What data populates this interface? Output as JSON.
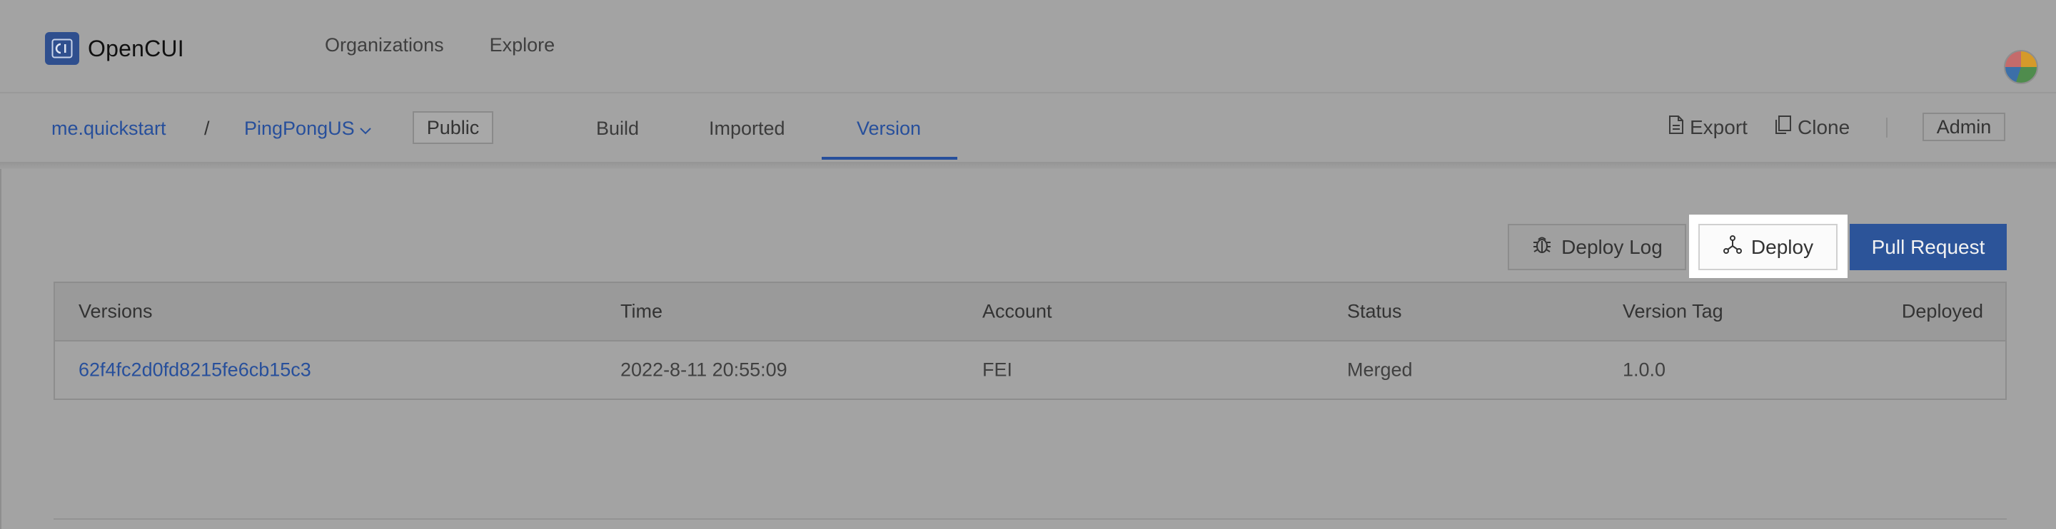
{
  "app": {
    "name": "OpenCUI"
  },
  "topnav": {
    "items": [
      "Organizations",
      "Explore"
    ]
  },
  "breadcrumb": {
    "org": "me.quickstart",
    "separator": "/",
    "project": "PingPongUS",
    "visibility": "Public"
  },
  "tabs": [
    {
      "label": "Build",
      "active": false
    },
    {
      "label": "Imported",
      "active": false
    },
    {
      "label": "Version",
      "active": true
    }
  ],
  "subactions": {
    "export": "Export",
    "clone": "Clone",
    "admin": "Admin"
  },
  "actions": {
    "deploy_log": "Deploy Log",
    "deploy": "Deploy",
    "pull_request": "Pull Request"
  },
  "table": {
    "columns": [
      "Versions",
      "Time",
      "Account",
      "Status",
      "Version Tag",
      "Deployed"
    ],
    "rows": [
      {
        "version": "62f4fc2d0fd8215fe6cb15c3",
        "time": "2022-8-11 20:55:09",
        "account": "FEI",
        "status": "Merged",
        "tag": "1.0.0",
        "deployed": ""
      }
    ]
  },
  "colors": {
    "accent": "#2c5499",
    "link": "#274f9b",
    "overlay": "#a3a3a3"
  },
  "icons": [
    "logo-icon",
    "chevron-down-icon",
    "export-icon",
    "clone-icon",
    "bug-icon",
    "deploy-icon",
    "avatar"
  ]
}
